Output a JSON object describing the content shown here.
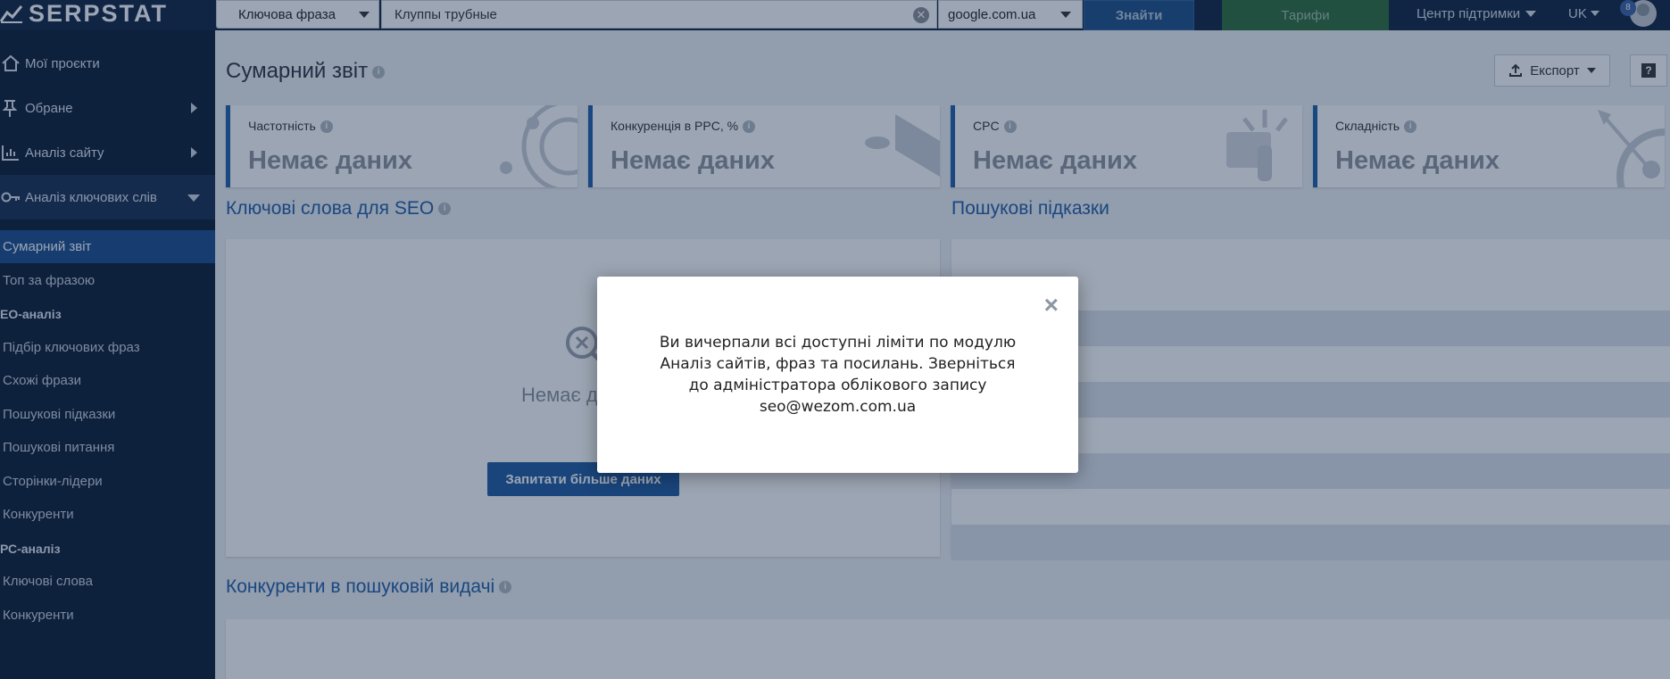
{
  "app": {
    "logo_text": "SERPSTAT"
  },
  "topbar": {
    "search_type": "Ключова фраза",
    "search_value": "Клуппы трубные",
    "database": "google.com.ua",
    "find_label": "Знайти",
    "tariffs_label": "Тарифи",
    "support_label": "Центр підтримки",
    "language": "UK",
    "notifications_count": "8"
  },
  "sidebar": {
    "main_items": [
      {
        "label": "Мої проєкти",
        "icon": "home-icon"
      },
      {
        "label": "Обране",
        "icon": "pin-icon"
      },
      {
        "label": "Аналіз сайту",
        "icon": "chart-icon"
      },
      {
        "label": "Аналіз ключових слів",
        "icon": "key-icon"
      }
    ],
    "sub_items": [
      {
        "label": "Сумарний звіт",
        "active": true
      },
      {
        "label": "Топ за фразою"
      }
    ],
    "seo_header": "ЕО-аналіз",
    "seo_items": [
      "Підбір ключових фраз",
      "Схожі фрази",
      "Пошукові підказки",
      "Пошукові питання",
      "Сторінки-лідери",
      "Конкуренти"
    ],
    "ppc_header": "РС-аналіз",
    "ppc_items": [
      "Ключові слова",
      "Конкуренти"
    ]
  },
  "main": {
    "page_title": "Сумарний звіт",
    "export_label": "Експорт",
    "help_label": "?",
    "metrics": [
      {
        "label": "Частотність",
        "value": "Немає даних"
      },
      {
        "label": "Конкуренція в PPC, %",
        "value": "Немає даних"
      },
      {
        "label": "CPC",
        "value": "Немає даних"
      },
      {
        "label": "Складність",
        "value": "Немає даних"
      }
    ],
    "seo_keywords_title": "Ключові слова для SEO",
    "search_hints_title": "Пошукові підказки",
    "nodata_partial": "Немає д",
    "request_more_label": "Запитати більше даних",
    "competitors_title": "Конкуренти в пошуковій видачі"
  },
  "modal": {
    "close_label": "×",
    "line1": "Ви вичерпали всі доступні ліміти по модулю",
    "line2": "Аналіз сайтів, фраз та посилань. Зверніться",
    "line3": "до адміністратора облікового запису",
    "line4": "seo@wezom.com.ua"
  },
  "colors": {
    "topbar": "#0f2240",
    "sidebar": "#0a1a33",
    "accent": "#1e5fa8",
    "tariff": "#2c6b3a"
  }
}
